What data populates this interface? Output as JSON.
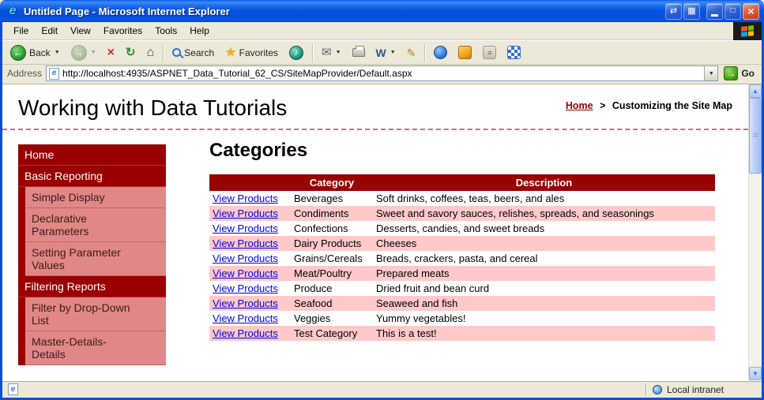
{
  "window": {
    "title": "Untitled Page - Microsoft Internet Explorer"
  },
  "menubar": {
    "items": [
      "File",
      "Edit",
      "View",
      "Favorites",
      "Tools",
      "Help"
    ]
  },
  "toolbar": {
    "back_label": "Back",
    "search_label": "Search",
    "favorites_label": "Favorites"
  },
  "addressbar": {
    "label": "Address",
    "url": "http://localhost:4935/ASPNET_Data_Tutorial_62_CS/SiteMapProvider/Default.aspx",
    "go_label": "Go"
  },
  "statusbar": {
    "zone": "Local intranet"
  },
  "icons": {
    "ie": "e",
    "screen_toggle": "⇄",
    "monitor": "▦",
    "maximize": "□",
    "close": "×",
    "back": "←",
    "forward": "→",
    "stop": "×",
    "refresh": "↻",
    "home": "⌂",
    "favorites": "★",
    "media": "♪",
    "mail": "✉",
    "word": "W",
    "edit": "✎",
    "research": "≡",
    "caret": "▼",
    "go": "→",
    "scroll_up": "▲",
    "scroll_down": "▼"
  },
  "page": {
    "title": "Working with Data Tutorials",
    "breadcrumb": {
      "home": "Home",
      "separator": ">",
      "current": "Customizing the Site Map"
    },
    "sidebar": {
      "items": [
        {
          "label": "Home",
          "level": 1
        },
        {
          "label": "Basic Reporting",
          "level": 1
        },
        {
          "label": "Simple Display",
          "level": 2
        },
        {
          "label": "Declarative Parameters",
          "level": 2
        },
        {
          "label": "Setting Parameter Values",
          "level": 2
        },
        {
          "label": "Filtering Reports",
          "level": 1
        },
        {
          "label": "Filter by Drop-Down List",
          "level": 2
        },
        {
          "label": "Master-Details-Details",
          "level": 2
        }
      ]
    },
    "main": {
      "heading": "Categories",
      "table": {
        "headers": [
          "",
          "Category",
          "Description"
        ],
        "link_label": "View Products",
        "rows": [
          {
            "category": "Beverages",
            "description": "Soft drinks, coffees, teas, beers, and ales"
          },
          {
            "category": "Condiments",
            "description": "Sweet and savory sauces, relishes, spreads, and seasonings"
          },
          {
            "category": "Confections",
            "description": "Desserts, candies, and sweet breads"
          },
          {
            "category": "Dairy Products",
            "description": "Cheeses"
          },
          {
            "category": "Grains/Cereals",
            "description": "Breads, crackers, pasta, and cereal"
          },
          {
            "category": "Meat/Poultry",
            "description": "Prepared meats"
          },
          {
            "category": "Produce",
            "description": "Dried fruit and bean curd"
          },
          {
            "category": "Seafood",
            "description": "Seaweed and fish"
          },
          {
            "category": "Veggies",
            "description": "Yummy vegetables!"
          },
          {
            "category": "Test Category",
            "description": "This is a test!"
          }
        ]
      }
    }
  },
  "colors": {
    "titlebar_blue": "#0A55E6",
    "chrome_bg": "#ECE9D8",
    "accent_maroon": "#990000",
    "subnav_salmon": "#E18787",
    "row_pink": "#FFC9C9",
    "link_blue": "#0000EE",
    "breadcrumb_link": "#990000",
    "divider_pink": "#CC6699",
    "go_green": "#4CA818"
  }
}
